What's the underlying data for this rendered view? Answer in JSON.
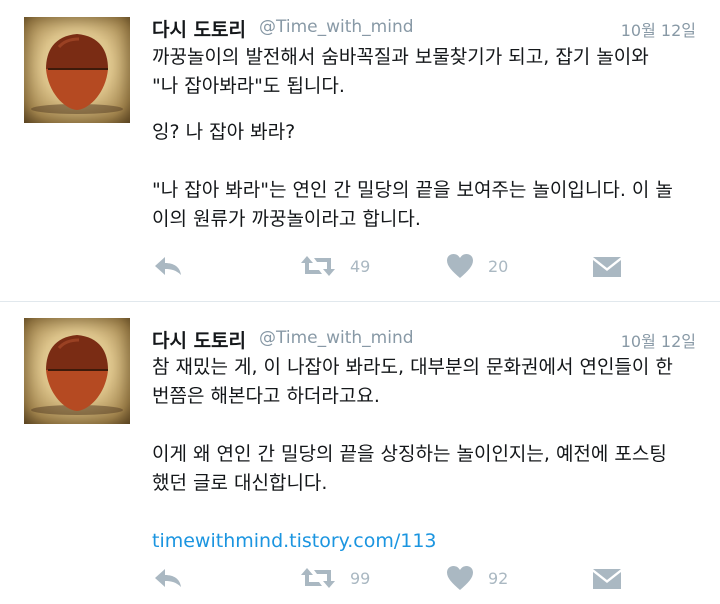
{
  "tweets": [
    {
      "author_name": "다시 도토리",
      "handle": "@Time_with_mind",
      "date": "10월 12일",
      "paragraphs": [
        "까꿍놀이의 발전해서 숨바꼭질과 보물찾기가 되고, 잡기 놀이와\n\"나 잡아봐라\"도 됩니다.",
        "잉? 나 잡아 봐라?",
        "\"나 잡아 봐라\"는 연인 간 밀당의 끝을 보여주는 놀이입니다. 이 놀\n이의 원류가 까꿍놀이라고 합니다."
      ],
      "link": "",
      "retweet_count": "49",
      "like_count": "20"
    },
    {
      "author_name": "다시 도토리",
      "handle": "@Time_with_mind",
      "date": "10월 12일",
      "paragraphs": [
        "참 재밌는 게, 이 나잡아 봐라도, 대부분의 문화권에서 연인들이 한\n번쯤은 해본다고 하더라고요.",
        "이게 왜 연인 간 밀당의 끝을 상징하는 놀이인지는, 예전에 포스팅\n했던 글로 대신합니다."
      ],
      "link": "timewithmind.tistory.com/113",
      "retweet_count": "99",
      "like_count": "92"
    }
  ],
  "icons": {
    "reply": "reply-icon",
    "retweet": "retweet-icon",
    "like": "heart-icon",
    "dm": "direct-message-icon"
  },
  "colors": {
    "text": "#14171a",
    "muted": "#8899a6",
    "icon": "#aab8c2",
    "link": "#1b95e0",
    "divider": "#e1e8ed"
  }
}
